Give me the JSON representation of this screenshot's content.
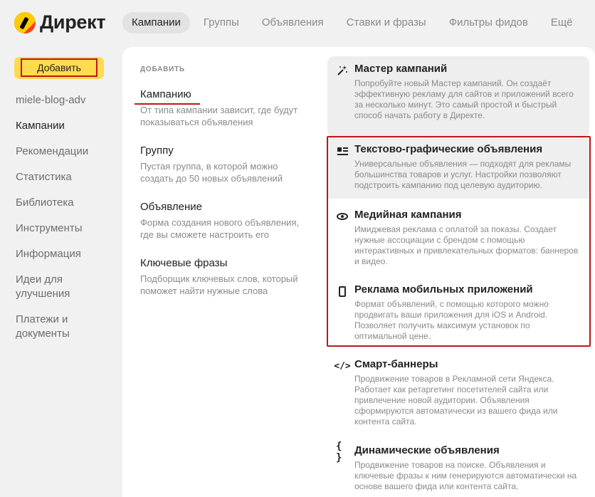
{
  "app": {
    "logo_text": "Директ"
  },
  "nav": {
    "items": [
      "Кампании",
      "Группы",
      "Объявления",
      "Ставки и фразы",
      "Фильтры фидов",
      "Ещё"
    ]
  },
  "sidebar": {
    "add_button": "Добавить",
    "items": [
      "miele-blog-adv",
      "Кампании",
      "Рекомендации",
      "Статистика",
      "Библиотека",
      "Инструменты",
      "Информация",
      "Идеи для улучшения",
      "Платежи и документы"
    ]
  },
  "add_menu": {
    "header": "ДОБАВИТЬ",
    "items": [
      {
        "title": "Кампанию",
        "desc": "От типа кампании зависит, где будут показываться объявления"
      },
      {
        "title": "Группу",
        "desc": "Пустая группа, в которой можно создать до 50 новых объявлений"
      },
      {
        "title": "Объявление",
        "desc": "Форма создания нового объявления, где вы сможете настроить его"
      },
      {
        "title": "Ключевые фразы",
        "desc": "Подборщик ключевых слов, который поможет найти нужные слова"
      }
    ]
  },
  "campaign_types": {
    "items": [
      {
        "icon": "magic-wand-icon",
        "title": "Мастер кампаний",
        "desc": "Попробуйте новый Мастер кампаний. Он создаёт эффективную рекламу для сайтов и приложений всего за несколько минут. Это самый простой и быстрый способ начать работу в Директе."
      },
      {
        "icon": "text-lines-icon",
        "title": "Текстово-графические объявления",
        "desc": "Универсальные объявления — подходят для рекламы большинства товаров и услуг. Настройки позволяют подстроить кампанию под целевую аудиторию."
      },
      {
        "icon": "eye-icon",
        "title": "Медийная кампания",
        "desc": "Имиджевая реклама с оплатой за показы. Создает нужные ассоциации с брендом с помощью интерактивных и привлекательных форматов: баннеров и видео."
      },
      {
        "icon": "phone-icon",
        "title": "Реклама мобильных приложений",
        "desc": "Формат объявлений, с помощью которого можно продвигать ваши приложения для iOS и Android. Позволяет получить максимум установок по оптимальной цене."
      },
      {
        "icon": "code-icon",
        "title": "Смарт-баннеры",
        "desc": "Продвижение товаров в Рекламной сети Яндекса. Работает как ретаргетинг посетителей сайта или привлечение новой аудитории. Объявления сформируются автоматически из вашего фида или контента сайта."
      },
      {
        "icon": "braces-icon",
        "title": "Динамические объявления",
        "desc": "Продвижение товаров на поиске. Объявления и ключевые фразы к ним генерируются автоматически на основе вашего фида или контента сайта."
      }
    ]
  },
  "colors": {
    "accent_yellow": "#ffdb4d",
    "highlight_red": "#c0161a",
    "muted_text": "#8a8a8a"
  }
}
